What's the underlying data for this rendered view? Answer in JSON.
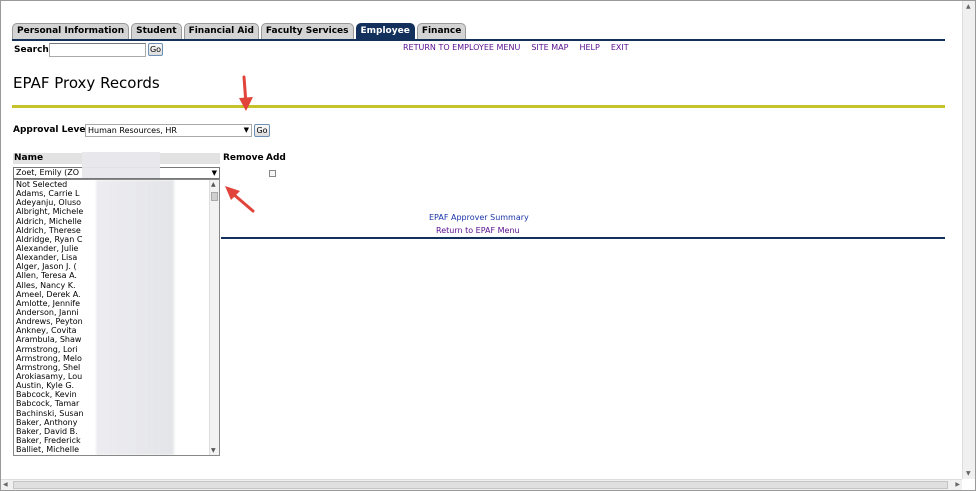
{
  "tabs": [
    "Personal Information",
    "Student",
    "Financial Aid",
    "Faculty Services",
    "Employee",
    "Finance"
  ],
  "active_tab": "Employee",
  "search": {
    "label": "Search",
    "value": "",
    "go": "Go"
  },
  "top_links": [
    "RETURN TO EMPLOYEE MENU",
    "SITE MAP",
    "HELP",
    "EXIT"
  ],
  "page_title": "EPAF Proxy Records",
  "approval": {
    "label": "Approval Level:",
    "value": "Human Resources, HR",
    "go": "Go"
  },
  "table": {
    "name_header": "Name",
    "remove_header": "Remove",
    "add_header": "Add"
  },
  "name_select": {
    "value": "Zoet, Emily (ZO"
  },
  "dropdown_items": [
    "Not Selected",
    "Adams, Carrie L",
    "Adeyanju, Oluso",
    "Albright, Michele",
    "Aldrich, Michelle",
    "Aldrich, Therese",
    "Aldridge, Ryan C",
    "Alexander, Julie",
    "Alexander, Lisa",
    "Alger, Jason J. (",
    "Allen, Teresa A.",
    "Alles, Nancy K.",
    "Ameel, Derek A.",
    "Amlotte, Jennife",
    "Anderson, Janni",
    "Andrews, Peyton",
    "Ankney, Covita",
    "Arambula, Shaw",
    "Armstrong, Lori",
    "Armstrong, Melo",
    "Armstrong, Shel",
    "Arokiasamy, Lou",
    "Austin, Kyle G.",
    "Babcock, Kevin",
    "Babcock, Tamar",
    "Bachinski, Susan",
    "Baker, Anthony",
    "Baker, David B.",
    "Baker, Frederick",
    "Balliet, Michelle"
  ],
  "links": {
    "summary": "EPAF Approver Summary",
    "return": "Return to EPAF Menu"
  },
  "colors": {
    "nav_blue": "#12305b",
    "rule_yellow": "#c7c12a",
    "arrow_red": "#e0443a",
    "visited_link": "#5a0f8f",
    "link": "#1a35a8"
  }
}
